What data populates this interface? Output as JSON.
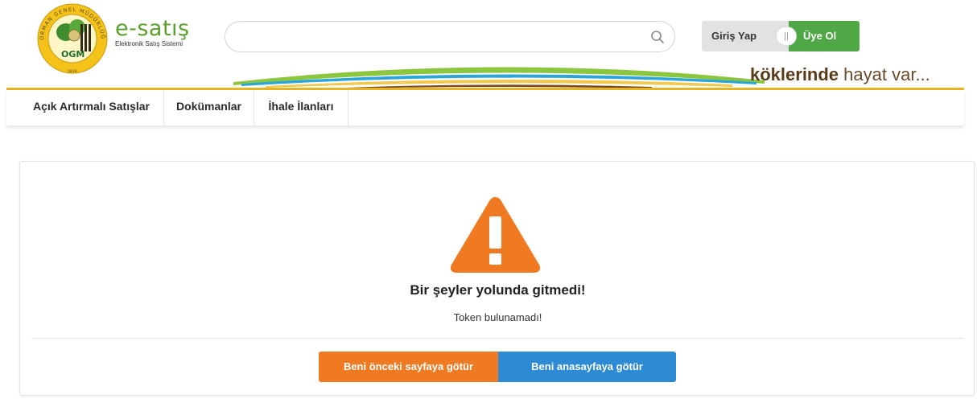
{
  "header": {
    "logo": {
      "seal_ring_text": "ORMAN GENEL MÜDÜRLÜĞÜ",
      "seal_initials": "OGM",
      "seal_year": "1839",
      "title": "e-satış",
      "subtitle": "Elektronik Satış Sistemi"
    },
    "search": {
      "value": "",
      "placeholder": "",
      "icon": "search-icon"
    },
    "auth": {
      "login_label": "Giriş Yap",
      "toggle_glyph": "||",
      "signup_label": "Üye Ol"
    },
    "slogan": {
      "bold": "köklerinde",
      "rest": " hayat var..."
    }
  },
  "nav": {
    "items": [
      {
        "label": "Açık Artırmalı Satışlar"
      },
      {
        "label": "Dokümanlar"
      },
      {
        "label": "İhale İlanları"
      }
    ]
  },
  "error": {
    "icon": "warning-icon",
    "title": "Bir şeyler yolunda gitmedi!",
    "message": "Token bulunamadı!",
    "back_button": "Beni önceki sayfaya götür",
    "home_button": "Beni anasayfaya götür"
  },
  "colors": {
    "brand_green": "#5aa02c",
    "signup_green": "#4fa845",
    "gold": "#e7b521",
    "warning_orange": "#f07a22",
    "home_blue": "#2d8ad5",
    "slogan_brown": "#5b3a1a"
  }
}
